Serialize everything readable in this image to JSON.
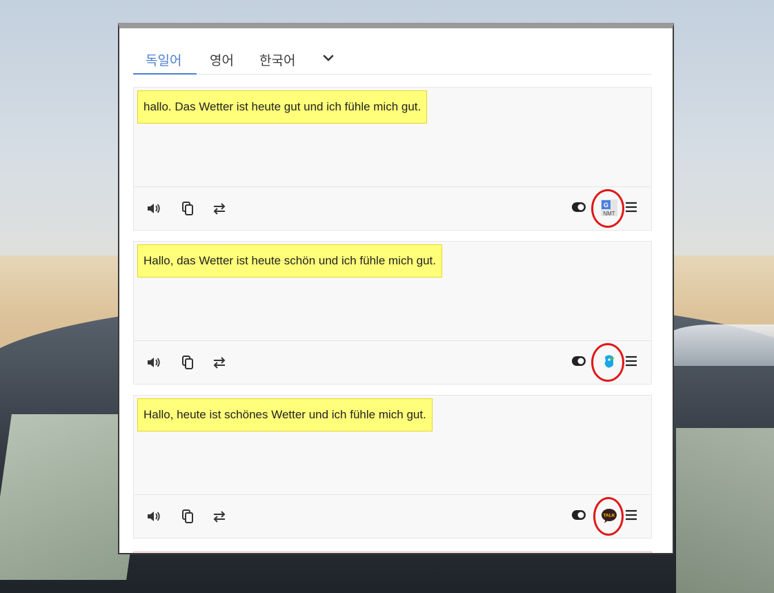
{
  "tabs": [
    {
      "label": "독일어",
      "active": true
    },
    {
      "label": "영어",
      "active": false
    },
    {
      "label": "한국어",
      "active": false
    }
  ],
  "more_languages_icon": "chevron-down-icon",
  "cards": [
    {
      "text": "hallo. Das Wetter ist heute gut und ich fühle mich gut.",
      "engine": "google-nmt",
      "engine_label": "NMT"
    },
    {
      "text": "Hallo, das Wetter ist heute schön und ich fühle mich gut.",
      "engine": "papago"
    },
    {
      "text": "Hallo, heute ist schönes Wetter und ich fühle mich gut.",
      "engine": "kakao",
      "engine_label": "TALK"
    }
  ],
  "toolbar_icons": [
    "speaker-icon",
    "copy-icon",
    "swap-icon",
    "toggle-icon",
    "menu-icon"
  ],
  "colors": {
    "accent": "#4d7fd1",
    "highlight": "#ffff7a",
    "annotation": "#e01818"
  }
}
